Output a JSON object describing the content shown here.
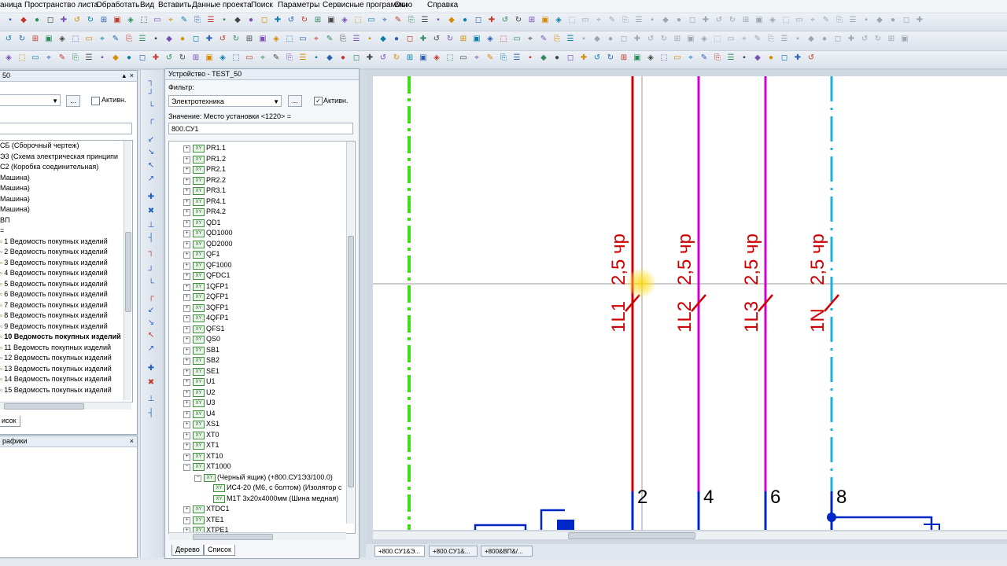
{
  "menubar": {
    "items": [
      "аница",
      "Пространство листа",
      "Обработать",
      "Вид",
      "Вставить",
      "Данные проекта",
      "Поиск",
      "Параметры",
      "Сервисные программы",
      "Окно",
      "Справка"
    ]
  },
  "left_panel": {
    "title": "50",
    "active_checkbox_label": "Активн.",
    "browse_label": "...",
    "items": [
      "СБ (Сборочный чертеж)",
      "Э3 (Схема электрическая принципи",
      "С2 (Коробка соединительная)",
      "Машина)",
      "Машина)",
      "Машина)",
      "Машина)",
      "ВП",
      "=",
      "1 Ведомость покупных изделий",
      "2 Ведомость покупных изделий",
      "3 Ведомость покупных изделий",
      "4 Ведомость покупных изделий",
      "5 Ведомость покупных изделий",
      "6 Ведомость покупных изделий",
      "7 Ведомость покупных изделий",
      "8 Ведомость покупных изделий",
      "9 Ведомость покупных изделий",
      "10 Ведомость покупных изделий",
      "11 Ведомость покупных изделий",
      "12 Ведомость покупных изделий",
      "13 Ведомость покупных изделий",
      "14 Ведомость покупных изделий",
      "15 Ведомость покупных изделий"
    ],
    "selected_item": "10 Ведомость покупных изделий",
    "tab_label": "исок"
  },
  "graphics_panel": {
    "title": "рафики"
  },
  "device_panel": {
    "title": "Устройство - TEST_50",
    "filter_label": "Фильтр:",
    "filter_value": "Электротехника",
    "browse_label": "...",
    "active_checkbox_label": "Активн.",
    "value_label": "Значение: Место установки <1220> =",
    "value_input": "800.СУ1",
    "tree_items": [
      "PR1.1",
      "PR1.2",
      "PR2.1",
      "PR2.2",
      "PR3.1",
      "PR4.1",
      "PR4.2",
      "QD1",
      "QD1000",
      "QD2000",
      "QF1",
      "QF1000",
      "QFDC1",
      "1QFP1",
      "2QFP1",
      "3QFP1",
      "4QFP1",
      "QFS1",
      "QS0",
      "SB1",
      "SB2",
      "SE1",
      "U1",
      "U2",
      "U3",
      "U4",
      "XS1",
      "XT0",
      "XT1",
      "XT10",
      "XT1000"
    ],
    "xt1000_children": [
      "(Черный ящик) (+800.СУ1Э3/100.0)",
      "ИС4-20 (М6, с болтом) (Изолятор с",
      "М1Т 3х20х4000мм (Шина медная)"
    ],
    "tree_items_after": [
      "XTDC1",
      "XTE1",
      "XTPE1"
    ],
    "tabs": [
      "Дерево",
      "Список"
    ]
  },
  "drawing": {
    "wire_labels": [
      {
        "name": "1L1",
        "size": "2,5 чр",
        "terminal": "2",
        "color": "#d00000"
      },
      {
        "name": "1L2",
        "size": "2,5 чр",
        "terminal": "4",
        "color": "#d000d0"
      },
      {
        "name": "1L3",
        "size": "2,5 чр",
        "terminal": "6",
        "color": "#d000d0"
      },
      {
        "name": "1N",
        "size": "2,5 чр",
        "terminal": "8",
        "color": "#19b3d6"
      }
    ],
    "colors": {
      "phase1": "#d00000",
      "phase23": "#d000d0",
      "neutral": "#19b3d6",
      "pe": "#3fe01a",
      "terminal": "#0026c8"
    }
  },
  "window_tabs": [
    "+800.СУ1&Э...",
    "+800.СУ1&...",
    "+800&ВП&/..."
  ]
}
